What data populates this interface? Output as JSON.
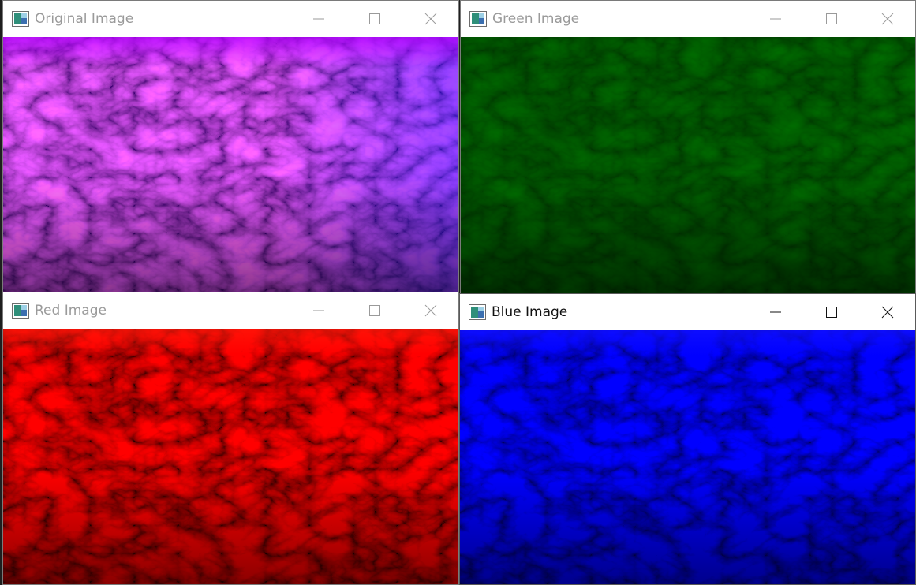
{
  "windows": {
    "original": {
      "title": "Original Image",
      "tint": "#7a1fb4",
      "active": false
    },
    "green": {
      "title": "Green Image",
      "tint": "#0b1f07",
      "active": false
    },
    "red": {
      "title": "Red Image",
      "tint": "#c8120c",
      "active": false
    },
    "blue": {
      "title": "Blue Image",
      "tint": "#1a1ae6",
      "active": true
    }
  },
  "icons": {
    "app": "image-window-icon",
    "minimize": "minimize-icon",
    "maximize": "maximize-icon",
    "close": "close-icon"
  }
}
